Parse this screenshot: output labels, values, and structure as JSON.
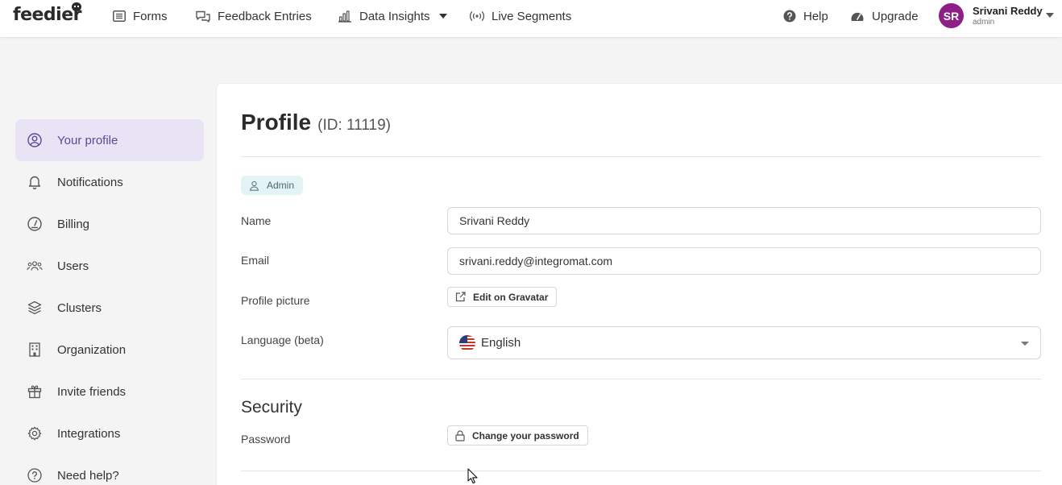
{
  "brand": {
    "name": "feedier"
  },
  "nav": {
    "items": [
      {
        "label": "Forms",
        "icon": "list-icon"
      },
      {
        "label": "Feedback Entries",
        "icon": "chat-bubbles-icon"
      },
      {
        "label": "Data Insights",
        "icon": "bar-chart-icon",
        "dropdown": true
      },
      {
        "label": "Live Segments",
        "icon": "broadcast-icon"
      }
    ],
    "help_label": "Help",
    "upgrade_label": "Upgrade",
    "user": {
      "initials": "SR",
      "name": "Srivani Reddy",
      "role": "admin",
      "avatar_color": "#8e1f86"
    }
  },
  "sidebar": {
    "items": [
      {
        "label": "Your profile",
        "icon": "user-circle-icon",
        "active": true
      },
      {
        "label": "Notifications",
        "icon": "bell-icon"
      },
      {
        "label": "Billing",
        "icon": "gauge-icon"
      },
      {
        "label": "Users",
        "icon": "users-icon"
      },
      {
        "label": "Clusters",
        "icon": "layers-icon"
      },
      {
        "label": "Organization",
        "icon": "building-icon"
      },
      {
        "label": "Invite friends",
        "icon": "gift-icon"
      },
      {
        "label": "Integrations",
        "icon": "gear-icon"
      },
      {
        "label": "Need help?",
        "icon": "question-circle-icon"
      }
    ]
  },
  "profile": {
    "title": "Profile",
    "id_text": "(ID: 11119)",
    "role_badge": "Admin",
    "name_label": "Name",
    "name_value": "Srivani Reddy",
    "email_label": "Email",
    "email_value": "srivani.reddy@integromat.com",
    "picture_label": "Profile picture",
    "gravatar_button": "Edit on Gravatar",
    "language_label": "Language (beta)",
    "language_value": "English"
  },
  "security": {
    "title": "Security",
    "password_label": "Password",
    "change_password_button": "Change your password"
  },
  "colors": {
    "accent": "#5a4a9a",
    "active_bg": "#e8e3f5",
    "badge_bg": "#e3f3f6"
  }
}
